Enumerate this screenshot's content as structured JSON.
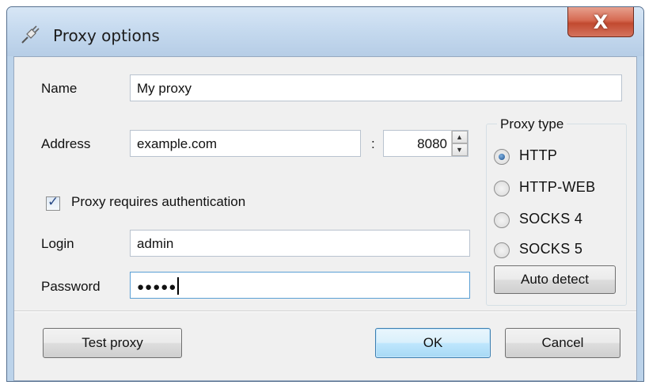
{
  "window": {
    "title": "Proxy options",
    "close_glyph": "X",
    "icon": "plug-icon"
  },
  "form": {
    "name_label": "Name",
    "name_value": "My proxy",
    "address_label": "Address",
    "address_value": "example.com",
    "port_separator": ":",
    "port_value": "8080",
    "auth_checkbox_label": "Proxy requires authentication",
    "auth_checked": true,
    "login_label": "Login",
    "login_value": "admin",
    "password_label": "Password",
    "password_value": "●●●●●"
  },
  "proxy_type": {
    "title": "Proxy type",
    "options": [
      {
        "label": "HTTP",
        "selected": true
      },
      {
        "label": "HTTP-WEB",
        "selected": false
      },
      {
        "label": "SOCKS 4",
        "selected": false
      },
      {
        "label": "SOCKS 5",
        "selected": false
      }
    ],
    "auto_detect_label": "Auto detect"
  },
  "buttons": {
    "test_proxy": "Test proxy",
    "ok": "OK",
    "cancel": "Cancel"
  },
  "colors": {
    "title_bar": "#c6daef",
    "close_button": "#c94f36",
    "dialog_background": "#f0f0f0",
    "default_button": "#bee6fd"
  }
}
